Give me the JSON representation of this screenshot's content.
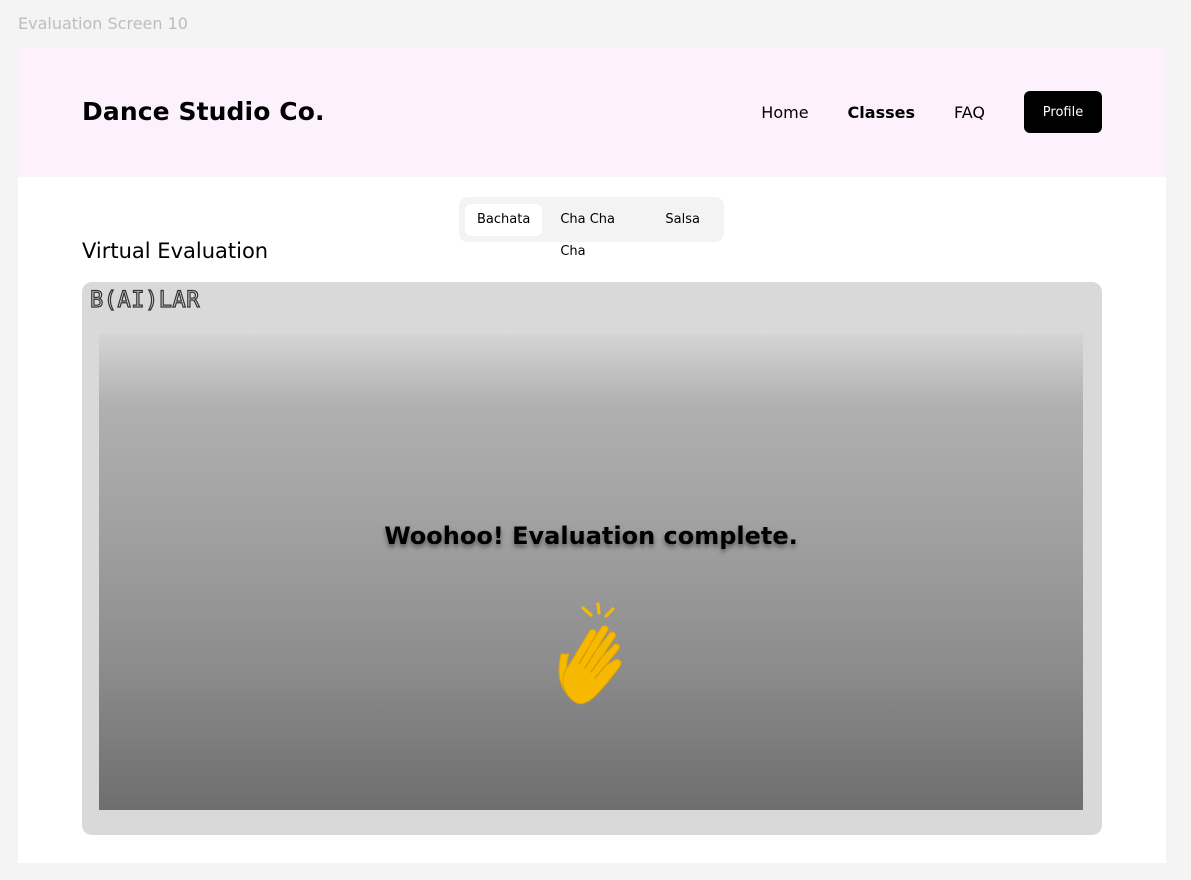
{
  "canvas": {
    "label": "Evaluation Screen 10"
  },
  "header": {
    "brand": "Dance Studio Co.",
    "nav": [
      {
        "label": "Home",
        "active": false
      },
      {
        "label": "Classes",
        "active": true
      },
      {
        "label": "FAQ",
        "active": false
      }
    ],
    "profile_label": "Profile",
    "background_color": "#fdf1fd"
  },
  "tabs": [
    {
      "label": "Bachata",
      "selected": true
    },
    {
      "label": "Cha Cha Cha",
      "selected": false
    },
    {
      "label": "Salsa",
      "selected": false
    }
  ],
  "main": {
    "section_title": "Virtual Evaluation",
    "logo_text": "B(AI)LAR",
    "message": "Woohoo! Evaluation complete.",
    "icon": "clapping-hands-icon",
    "icon_color": "#f6b800"
  }
}
